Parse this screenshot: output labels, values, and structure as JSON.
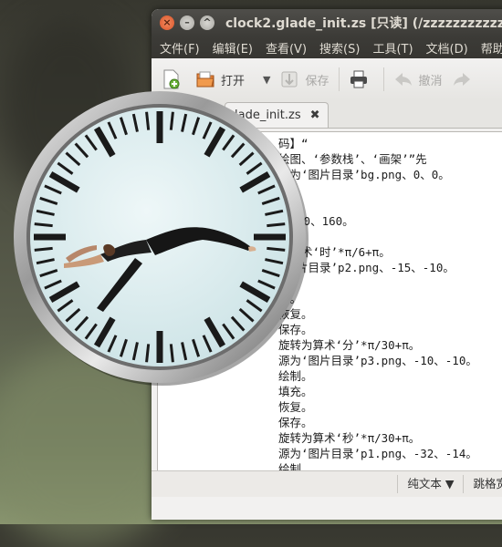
{
  "window": {
    "title": "clock2.glade_init.zs [只读] (/zzzzzzzzzzz/"
  },
  "menubar": [
    "文件(F)",
    "编辑(E)",
    "查看(V)",
    "搜索(S)",
    "工具(T)",
    "文档(D)",
    "帮助(H)"
  ],
  "toolbar": {
    "open_label": "打开",
    "dropdown": "▼",
    "save_label": "保存",
    "undo_label": "撤消"
  },
  "tab": {
    "label": "lade_init.zs",
    "close": "✖"
  },
  "editor": {
    "lines": [
      "码】“",
      "绘图、‘参数栈’、‘画架’”先",
      "源为‘图片目录’bg.png、0、0。",
      "制。",
      "充。",
      "为160、160。",
      "",
      "为算术‘时’*π/6+π。",
      "‘图片目录’p2.png、-15、-10。",
      "制。",
      "充。",
      "恢复。",
      "保存。",
      "旋转为算术‘分’*π/30+π。",
      "源为‘图片目录’p3.png、-10、-10。",
      "绘制。",
      "填充。",
      "恢复。",
      "保存。",
      "旋转为算术‘秒’*π/30+π。",
      "源为‘图片目录’p1.png、-32、-14。",
      "绘制"
    ]
  },
  "statusbar": {
    "mode": "纯文本 ▼",
    "wrap": "跳格宽"
  },
  "clock": {
    "hour": 3,
    "minute": 42,
    "second": 16
  }
}
